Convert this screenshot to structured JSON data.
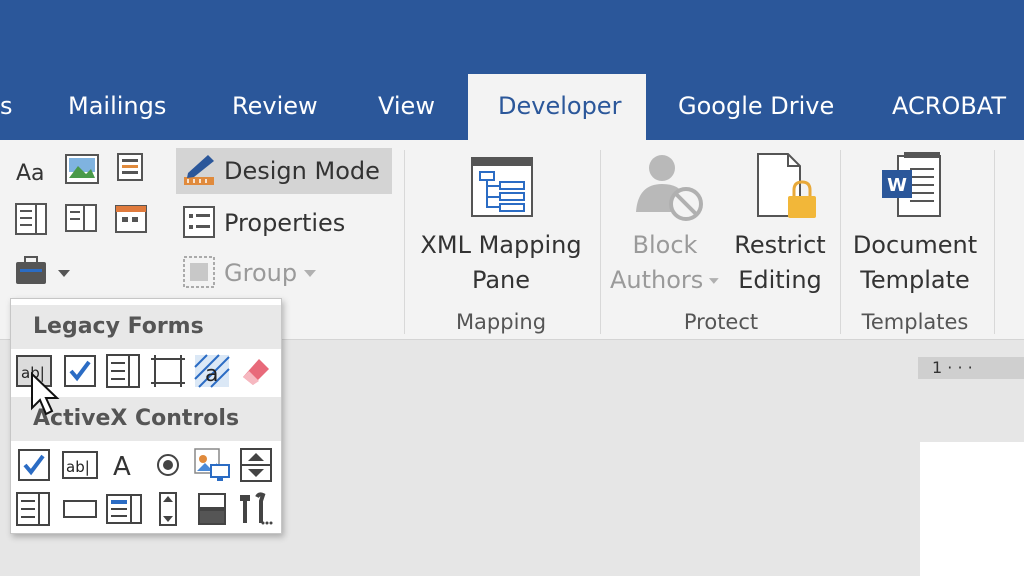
{
  "tabs": {
    "partial": "s",
    "mailings": "Mailings",
    "review": "Review",
    "view": "View",
    "developer": "Developer",
    "google_drive": "Google Drive",
    "acrobat": "ACROBAT"
  },
  "controls_group": {
    "design_mode": "Design Mode",
    "properties": "Properties",
    "group": "Group"
  },
  "mapping": {
    "button_line1": "XML Mapping",
    "button_line2": "Pane",
    "label": "Mapping"
  },
  "protect": {
    "block_line1": "Block",
    "block_line2": "Authors",
    "restrict_line1": "Restrict",
    "restrict_line2": "Editing",
    "label": "Protect"
  },
  "templates": {
    "button_line1": "Document",
    "button_line2": "Template",
    "label": "Templates"
  },
  "ruler": {
    "text": "1 · · ·"
  },
  "dropdown": {
    "legacy_header": "Legacy Forms",
    "activex_header": "ActiveX Controls",
    "legacy_text_icon_label": "ab|",
    "activex_text_icon_label": "ab|"
  },
  "colors": {
    "title_blue": "#2b579a",
    "ribbon_bg": "#f3f3f3",
    "check_blue": "#2b6cc4"
  }
}
